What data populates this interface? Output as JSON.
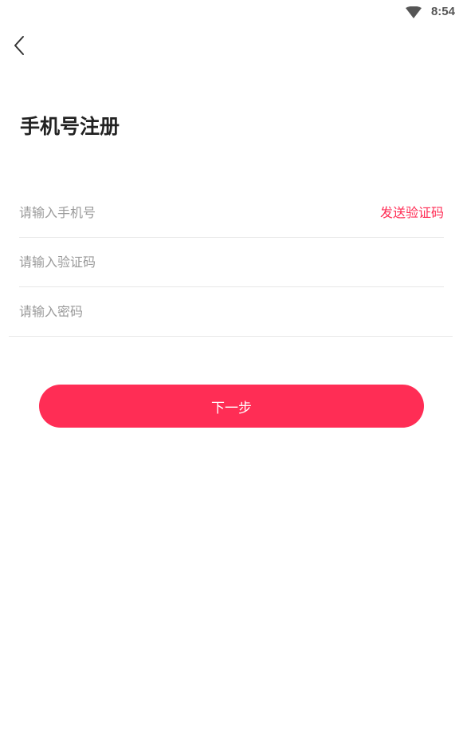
{
  "status_bar": {
    "time": "8:54",
    "wifi_icon": "wifi-icon"
  },
  "nav": {
    "back_icon": "chevron-left-icon"
  },
  "page": {
    "title": "手机号注册"
  },
  "form": {
    "phone_placeholder": "请输入手机号",
    "phone_value": "",
    "send_code_label": "发送验证码",
    "code_placeholder": "请输入验证码",
    "code_value": "",
    "password_placeholder": "请输入密码",
    "password_value": ""
  },
  "actions": {
    "next_label": "下一步"
  },
  "colors": {
    "accent": "#ff2d55",
    "title": "#222222",
    "placeholder": "#9a9a9a",
    "divider": "#e8e8e8"
  }
}
